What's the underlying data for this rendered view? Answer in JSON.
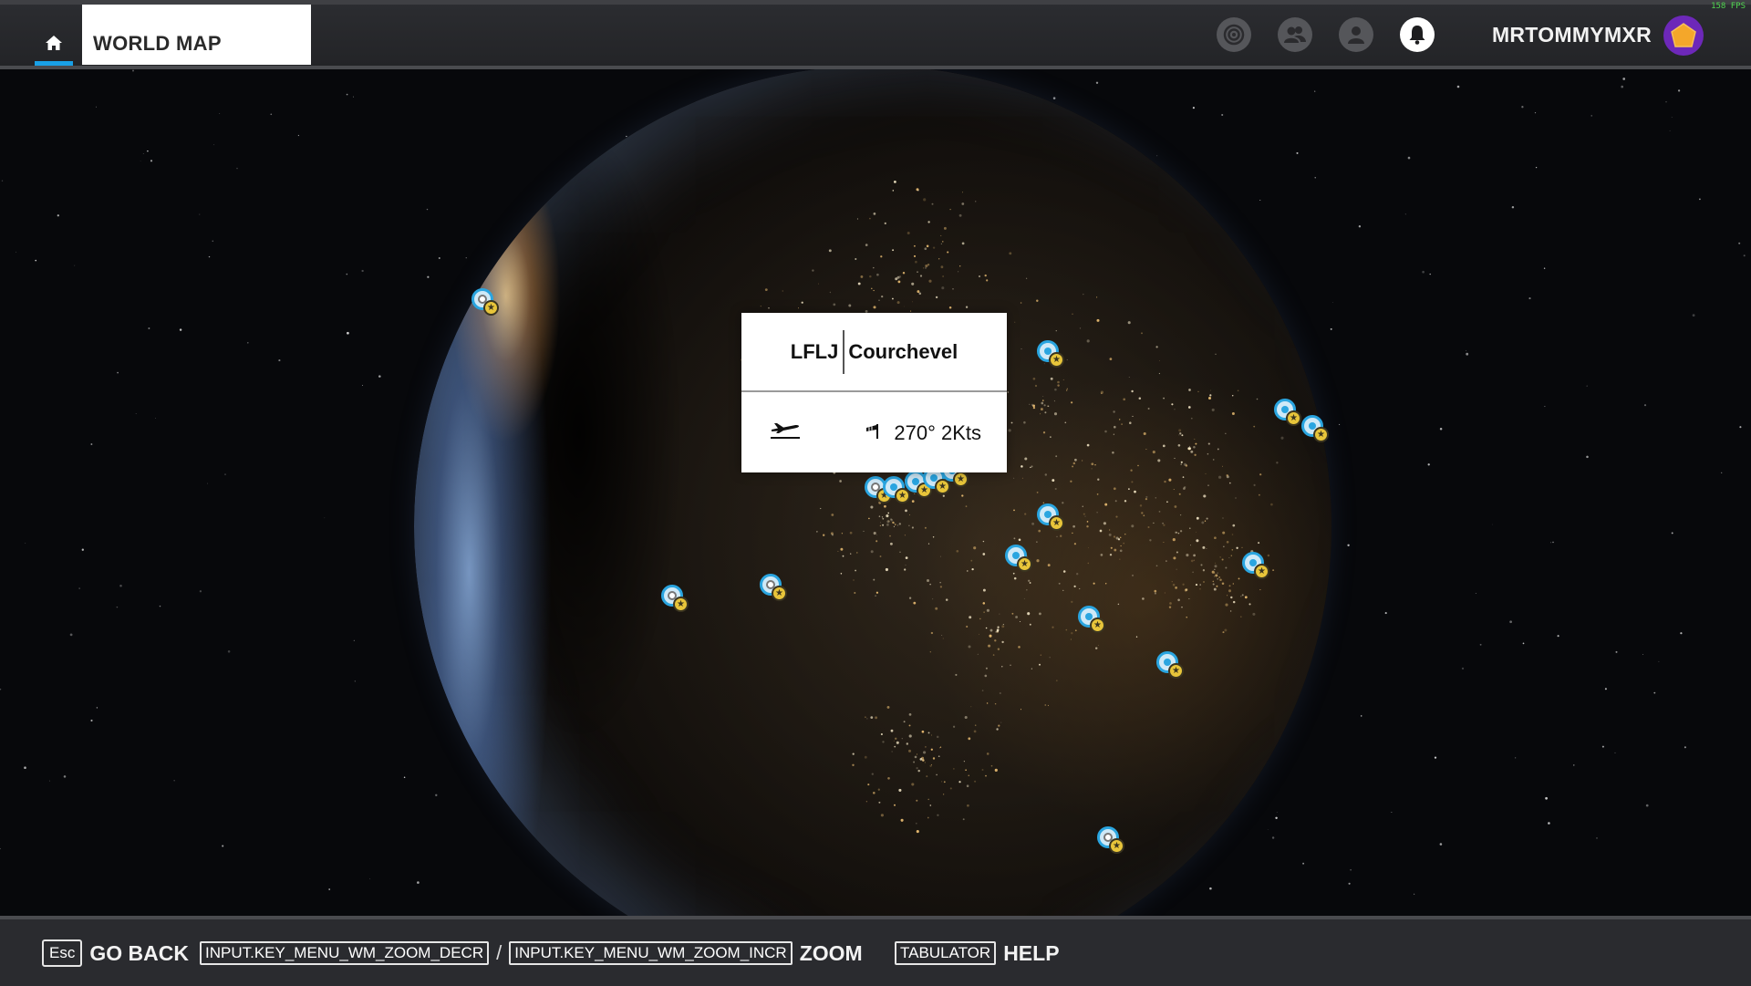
{
  "header": {
    "title": "WORLD MAP",
    "home_icon": "home-icon",
    "icons": [
      "activity-icon",
      "friends-icon",
      "profile-icon",
      "notifications-icon"
    ],
    "username": "MRTOMMYMXR",
    "avatar_icon": "pentagon-avatar-icon",
    "fps": "158 FPS",
    "accent_color": "#19a0e6"
  },
  "popup": {
    "icao": "LFLJ",
    "name": "Courchevel",
    "wind": "270° 2Kts",
    "plane_icon": "airplane-takeoff-icon",
    "wind_icon": "windsock-icon"
  },
  "footer": {
    "back_key": "Esc",
    "back_label": "GO BACK",
    "zoom_decr_key": "INPUT.KEY_MENU_WM_ZOOM_DECR",
    "separator": "/",
    "zoom_incr_key": "INPUT.KEY_MENU_WM_ZOOM_INCR",
    "zoom_label": "ZOOM",
    "help_key": "TABULATOR",
    "help_label": "HELP"
  },
  "map": {
    "marker_icon": "airport-marker-icon",
    "badge_icon": "star-badge-icon",
    "marker_color": "#2aa5e0",
    "badge_color": "#e8c53a"
  }
}
